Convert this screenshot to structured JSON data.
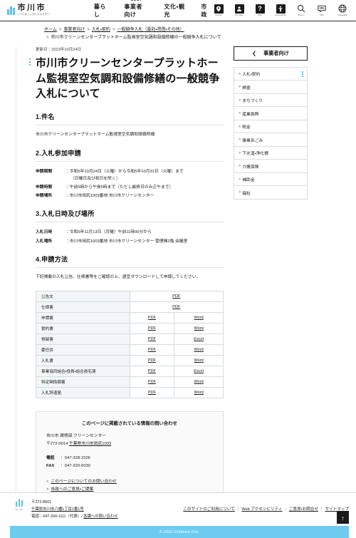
{
  "header": {
    "logo_name": "市川市",
    "logo_tagline": "いつも新しい流れがある市川",
    "nav": [
      {
        "label": "暮らし",
        "active": false
      },
      {
        "label": "事業者向け",
        "active": true
      },
      {
        "label": "文化・観光",
        "active": false
      },
      {
        "label": "市政",
        "active": false
      }
    ],
    "utilities": [
      {
        "icon": "location-pin-icon",
        "caption": "Access"
      },
      {
        "icon": "user-mypage-icon",
        "caption": "My page"
      },
      {
        "icon": "question-mark-icon",
        "caption": "FAQ"
      },
      {
        "icon": "accessibility-icon",
        "caption": "Accessibility"
      },
      {
        "icon": "search-icon",
        "caption": "Search"
      },
      {
        "icon": "sns-speech-bubble-icon",
        "caption": "SNS"
      },
      {
        "icon": "globe-language-icon",
        "caption": "Language"
      }
    ]
  },
  "breadcrumb": {
    "items": [
      "ホーム",
      "事業者向け",
      "入札・契約",
      "一般競争入札（委託・賃借・その他）"
    ],
    "current": "市川市クリーンセンタープラットホーム監視室空気調和設備修繕の一般競争入札について"
  },
  "article": {
    "updated_label": "更新日：",
    "updated_date": "2023年10月24日",
    "title": "市川市クリーンセンタープラットホーム監視室空気調和設備修繕の一般競争入札について",
    "s1": {
      "heading": "1.件名",
      "text": "市川市クリーンセンタープラットホーム監視室空気調和設備修繕"
    },
    "s2": {
      "heading": "2.入札参加申請",
      "rows": [
        {
          "term": "申請期間",
          "value": "：令和5年10月24日（火曜）から令和5年10月31日（火曜）まで",
          "cont": "（日曜日及び祝日を除く）"
        },
        {
          "term": "申請時間",
          "value": "：午前9時から午後5時まで（ただし最終日のみ正午まで）",
          "cont": ""
        },
        {
          "term": "申請場所",
          "value": "：市川市田尻1003番地 市川市クリーンセンター",
          "cont": ""
        }
      ]
    },
    "s3": {
      "heading": "3.入札日時及び場所",
      "rows": [
        {
          "term": "入札日時",
          "value": "：令和5年11月13日（月曜）午前11時00分から",
          "cont": ""
        },
        {
          "term": "入札場所",
          "value": "：市川市田尻1003番地 市川市クリーンセンター 管理棟2階 会議室",
          "cont": ""
        }
      ]
    },
    "s4": {
      "heading": "4.申請方法",
      "text": "下記掲載の入札公告、仕様書等をご確認の上、適宜ダウンロードして申請してください。",
      "table": [
        {
          "label": "公告文",
          "cols": [
            {
              "text": "PDF",
              "span": 2
            }
          ]
        },
        {
          "label": "仕様書",
          "cols": [
            {
              "text": "PDF",
              "span": 2
            }
          ]
        },
        {
          "label": "申請書",
          "cols": [
            {
              "text": "PDF",
              "span": 1
            },
            {
              "text": "Word",
              "span": 1
            }
          ]
        },
        {
          "label": "誓約書",
          "cols": [
            {
              "text": "PDF",
              "span": 1
            },
            {
              "text": "Word",
              "span": 1
            }
          ]
        },
        {
          "label": "質疑書",
          "cols": [
            {
              "text": "PDF",
              "span": 1
            },
            {
              "text": "Excel",
              "span": 1
            }
          ]
        },
        {
          "label": "委任状",
          "cols": [
            {
              "text": "PDF",
              "span": 1
            },
            {
              "text": "Word",
              "span": 1
            }
          ]
        },
        {
          "label": "入札書",
          "cols": [
            {
              "text": "PDF",
              "span": 1
            },
            {
              "text": "Word",
              "span": 1
            }
          ]
        },
        {
          "label": "事業協同組合・役員・組合員名簿",
          "cols": [
            {
              "text": "PDF",
              "span": 1
            },
            {
              "text": "Excel",
              "span": 1
            }
          ]
        },
        {
          "label": "特定関係調書",
          "cols": [
            {
              "text": "PDF",
              "span": 1
            },
            {
              "text": "Word",
              "span": 1
            }
          ]
        },
        {
          "label": "入札辞退届",
          "cols": [
            {
              "text": "PDF",
              "span": 1
            },
            {
              "text": "Word",
              "span": 1
            }
          ]
        }
      ]
    }
  },
  "contact": {
    "heading": "このページに掲載されている情報の問い合わせ",
    "dept": "市川市 環境部 クリーンセンター",
    "zip": "〒272-0014",
    "address": "千葉県市川市田尻1003",
    "tel_label": "電話",
    "tel": "：047-328-2326",
    "fax_label": "FAX",
    "fax": "：047-320-5030",
    "links": [
      "このページについてのお問い合わせ",
      "市政へのご意見・ご提案"
    ]
  },
  "sidebar": {
    "header_label": "事業者向け",
    "back_icon": "chevron-left-icon",
    "items": [
      {
        "label": "入札・契約",
        "active": true
      },
      {
        "label": "検査",
        "active": false
      },
      {
        "label": "まちづくり",
        "active": false
      },
      {
        "label": "産業振興",
        "active": false
      },
      {
        "label": "税金",
        "active": false
      },
      {
        "label": "事業系ごみ",
        "active": false
      },
      {
        "label": "下水道・浄化槽",
        "active": false
      },
      {
        "label": "介護保険",
        "active": false
      },
      {
        "label": "補助金",
        "active": false
      },
      {
        "label": "福祉",
        "active": false
      }
    ]
  },
  "footer": {
    "logo_caption": "市川市",
    "zip": "〒272-8501",
    "address": "千葉県市川市八幡1丁目1番1号",
    "tel_line": "電話：047-334-1111（代表）/ ",
    "tel_link": "各課への問い合わせ",
    "links": [
      "このサイトのご利用について",
      "Web アクセシビリティ",
      "ご意見・お問合せ",
      "サイトマップ"
    ],
    "to_top_icon": "arrow-up-icon",
    "copyright": "© 2020 Ichikawa City."
  }
}
